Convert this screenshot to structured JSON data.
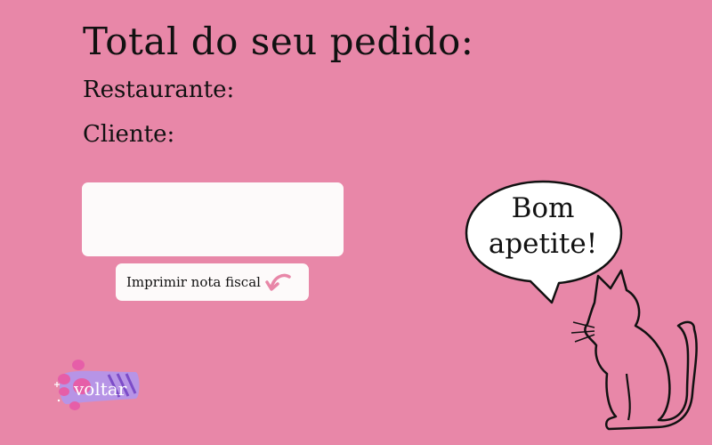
{
  "page": {
    "title": "Total do seu pedido:"
  },
  "order": {
    "restaurant_label": "Restaurante:",
    "client_label": "Cliente:",
    "details_box": ""
  },
  "actions": {
    "print_label": "Imprimir nota fiscal",
    "print_icon": "curved-arrow-icon",
    "back_label": "voltar",
    "back_icon": "paw-icon"
  },
  "illustration": {
    "speech_text_line1": "Bom",
    "speech_text_line2": "apetite!",
    "cat": "cat-outline-icon"
  },
  "colors": {
    "background": "#e887a8",
    "panel": "#fdfafa",
    "accent_arrow": "#e887a8",
    "paw_purple": "#b087e0",
    "paw_pink": "#e85aa6"
  }
}
